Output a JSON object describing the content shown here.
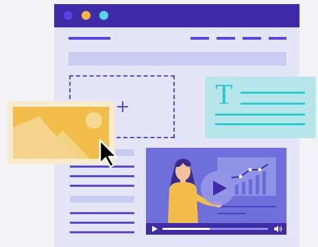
{
  "colors": {
    "page_bg": "#f3f3f7",
    "window_bg": "#e4e5f7",
    "titlebar": "#3f2ba7",
    "accent": "#5a41e6",
    "dot_blue": "#5a41e6",
    "dot_yellow": "#f5b63c",
    "dot_cyan": "#56d7e8",
    "text_card_bg": "#b7e6ea",
    "text_card_lines": "#2cc9d2",
    "image_card_bg": "#f7ebcc",
    "image_fill": "#f2bd4a",
    "video_bg": "#6f6fdc"
  },
  "text_card": {
    "glyph": "T"
  },
  "video_player": {
    "progress_fraction": 0.45
  },
  "icons": {
    "window_dots": [
      "close-dot",
      "minimize-dot",
      "maximize-dot"
    ],
    "add": "plus-icon",
    "cursor": "arrow-cursor-icon",
    "play": "play-icon",
    "volume": "volume-icon"
  }
}
